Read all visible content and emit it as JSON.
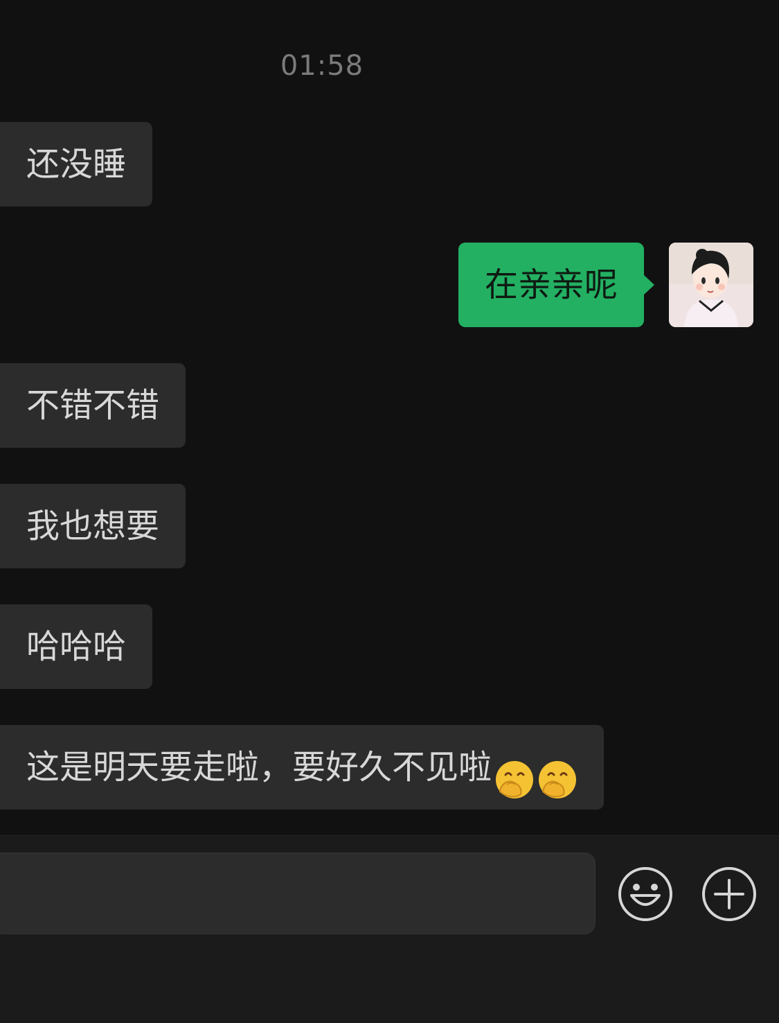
{
  "chat": {
    "timestamp": "01:58",
    "messages": [
      {
        "side": "in",
        "text": "还没睡"
      },
      {
        "side": "out",
        "text": "在亲亲呢"
      },
      {
        "side": "in",
        "text": "不错不错"
      },
      {
        "side": "in",
        "text": "我也想要"
      },
      {
        "side": "in",
        "text": "哈哈哈"
      },
      {
        "side": "in",
        "text": "这是明天要走啦，要好久不见啦",
        "emojis": [
          "face-with-hand-over-mouth-emoji",
          "face-with-hand-over-mouth-emoji"
        ]
      }
    ]
  },
  "composer": {
    "input_value": "",
    "emoji_button_icon": "smiley-face-icon",
    "plus_button_icon": "plus-circle-icon"
  },
  "colors": {
    "background": "#111111",
    "incoming_bubble": "#2c2c2c",
    "outgoing_bubble": "#23b062",
    "timestamp_text": "#7b7b7b"
  }
}
